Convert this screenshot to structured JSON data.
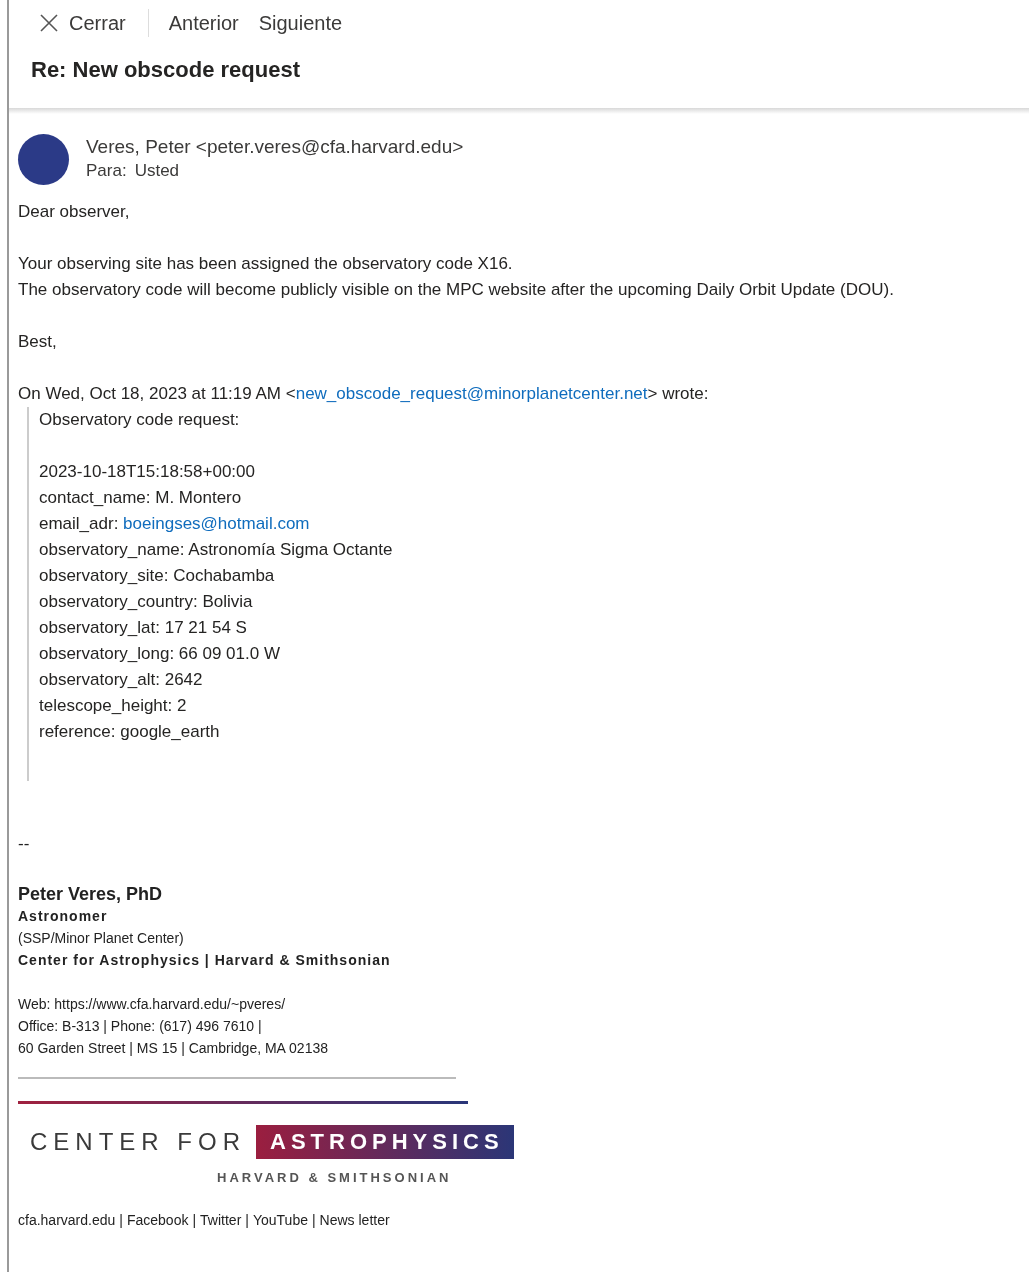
{
  "toolbar": {
    "close": "Cerrar",
    "previous": "Anterior",
    "next": "Siguiente"
  },
  "subject": "Re: New obscode request",
  "sender": {
    "from": "Veres, Peter <peter.veres@cfa.harvard.edu>",
    "to_label": "Para:",
    "to": "Usted"
  },
  "body": {
    "greeting": "Dear observer,",
    "paragraph": [
      "Your observing site has been assigned the observatory code X16.",
      "The observatory code will become publicly visible on the MPC website after the upcoming Daily Orbit Update (DOU)."
    ],
    "closing": "Best,"
  },
  "quote": {
    "intro": "On Wed, Oct 18, 2023 at 11:19 AM <",
    "intro_link": "new_obscode_request@minorplanetcenter.net",
    "intro_end": "> wrote:",
    "title": "Observatory code request:",
    "lines": [
      {
        "text": "2023-10-18T15:18:58+00:00"
      },
      {
        "text": "contact_name: M. Montero"
      },
      {
        "text": "email_adr: ",
        "link": "boeingses@hotmail.com"
      },
      {
        "text": "observatory_name: Astronomía Sigma Octante"
      },
      {
        "text": "observatory_site: Cochabamba"
      },
      {
        "text": "observatory_country: Bolivia"
      },
      {
        "text": "observatory_lat: 17 21 54 S"
      },
      {
        "text": "observatory_long: 66 09 01.0 W"
      },
      {
        "text": "observatory_alt: 2642"
      },
      {
        "text": "telescope_height: 2"
      },
      {
        "text": "reference: google_earth"
      }
    ]
  },
  "signature": {
    "dashes": "--",
    "name": "Peter Veres, PhD",
    "role": "Astronomer",
    "dept": "(SSP/Minor Planet Center)",
    "org": "Center for Astrophysics | Harvard &  Smithsonian",
    "web_label": "Web: ",
    "web_link": "https://www.cfa.harvard.edu/~pveres/",
    "office": "Office: B-313 | Phone: (617) 496 7610 |",
    "address": "60 Garden Street | MS 15 | Cambridge, MA 02138",
    "logo": {
      "left": "CENTER FOR",
      "right": "ASTROPHYSICS",
      "sub": "HARVARD & SMITHSONIAN"
    },
    "links": [
      "cfa.harvard.edu",
      "Facebook",
      "Twitter",
      "YouTube",
      "News letter"
    ],
    "separator": "|"
  }
}
